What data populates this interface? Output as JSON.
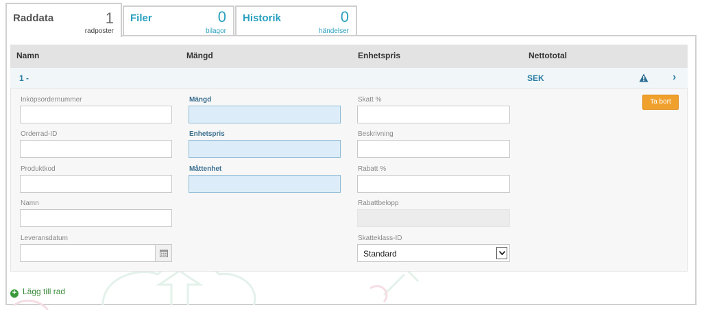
{
  "tabs": [
    {
      "label": "Raddata",
      "count": "1",
      "sub": "radposter"
    },
    {
      "label": "Filer",
      "count": "0",
      "sub": "bilagor"
    },
    {
      "label": "Historik",
      "count": "0",
      "sub": "händelser"
    }
  ],
  "table": {
    "headers": [
      "Namn",
      "Mängd",
      "Enhetspris",
      "Nettototal"
    ]
  },
  "row": {
    "number": "1 -",
    "currency": "SEK",
    "warning_icon": "warning-triangle-icon",
    "expand_icon": "chevron-right-icon"
  },
  "fields": {
    "inkopsordernummer": {
      "label": "Inköpsordernummer",
      "value": ""
    },
    "orderrad_id": {
      "label": "Orderrad-ID",
      "value": ""
    },
    "produktkod": {
      "label": "Produktkod",
      "value": ""
    },
    "namn": {
      "label": "Namn",
      "value": ""
    },
    "leveransdatum": {
      "label": "Leveransdatum",
      "value": ""
    },
    "mangd": {
      "label": "Mängd",
      "value": ""
    },
    "enhetspris": {
      "label": "Enhetspris",
      "value": ""
    },
    "mattenhet": {
      "label": "Måttenhet",
      "value": ""
    },
    "skatt": {
      "label": "Skatt %",
      "value": ""
    },
    "beskrivning": {
      "label": "Beskrivning",
      "value": ""
    },
    "rabatt": {
      "label": "Rabatt %",
      "value": ""
    },
    "rabattbelopp": {
      "label": "Rabattbelopp",
      "value": ""
    },
    "skatteklass": {
      "label": "Skatteklass-ID",
      "value": "Standard"
    }
  },
  "buttons": {
    "delete": "Ta bort",
    "add_row": "Lägg till rad"
  },
  "colors": {
    "accent": "#2aa0bf",
    "link": "#2b7fa4",
    "delete": "#f0a02c",
    "add": "#3a9a3a",
    "highlight_input": "#dcecf8"
  }
}
